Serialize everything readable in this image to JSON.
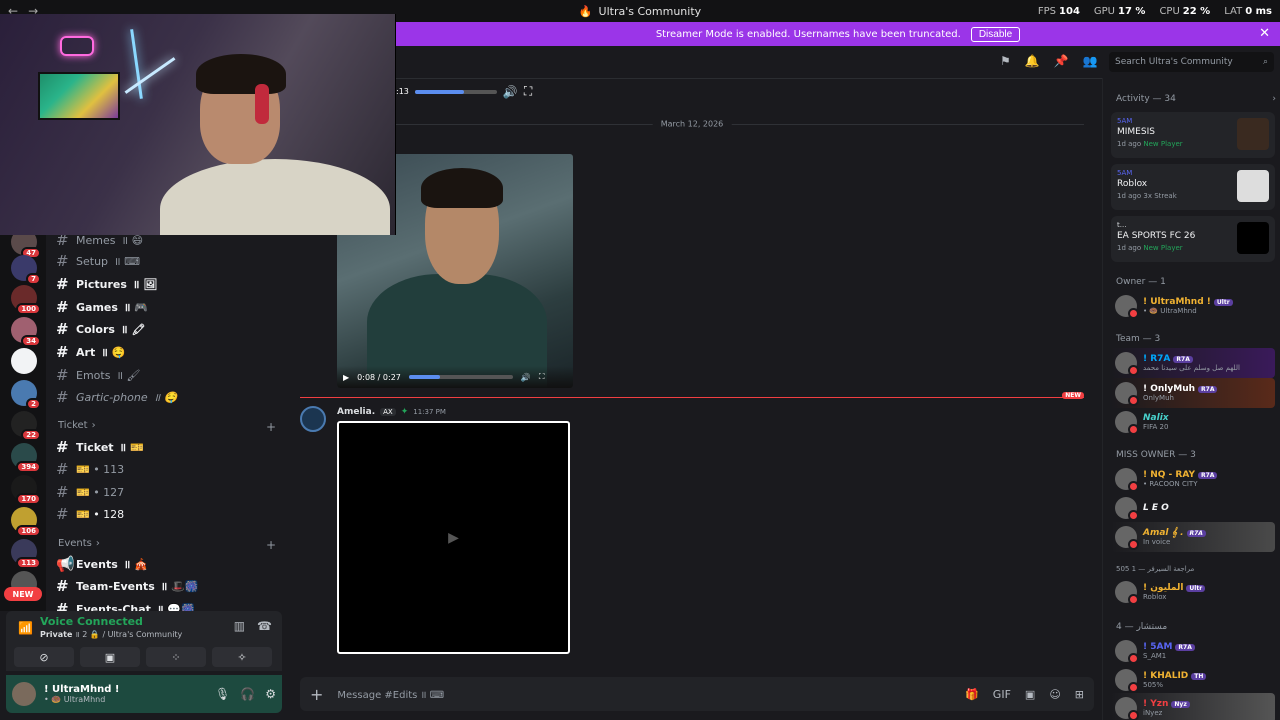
{
  "titlebar": {
    "title": "Ultra's Community",
    "stats": [
      {
        "label": "FPS",
        "value": "104"
      },
      {
        "label": "GPU",
        "value": "17 %"
      },
      {
        "label": "CPU",
        "value": "22 %"
      },
      {
        "label": "LAT",
        "value": "0 ms"
      }
    ]
  },
  "banner": {
    "text": "Streamer Mode is enabled. Usernames have been truncated.",
    "disable_label": "Disable"
  },
  "servers": [
    {
      "badge": "47"
    },
    {
      "badge": "7"
    },
    {
      "badge": "100"
    },
    {
      "badge": "34"
    },
    {
      "badge": ""
    },
    {
      "badge": "2"
    },
    {
      "badge": "22"
    },
    {
      "badge": "394"
    },
    {
      "badge": "170"
    },
    {
      "badge": "106"
    },
    {
      "badge": "113"
    },
    {
      "badge": ""
    }
  ],
  "new_pill": "NEW",
  "channels": {
    "items": [
      {
        "name": "Memes",
        "suffix": "॥ 😄"
      },
      {
        "name": "Setup",
        "suffix": "॥ ⌨"
      },
      {
        "name": "Pictures",
        "suffix": "॥ 🖼"
      },
      {
        "name": "Games",
        "suffix": "॥ 🎮"
      },
      {
        "name": "Colors",
        "suffix": "॥ 🖍"
      },
      {
        "name": "Art",
        "suffix": "॥ 🤤"
      },
      {
        "name": "Emots",
        "suffix": "॥ 🖌"
      },
      {
        "name": "Gartic-phone",
        "suffix": "॥ 🤤"
      }
    ],
    "ticket_category": "Ticket",
    "ticket_items": [
      {
        "name": "Ticket",
        "suffix": "॥ 🎫"
      },
      {
        "name": "🎫 • 113",
        "suffix": ""
      },
      {
        "name": "🎫 • 127",
        "suffix": ""
      },
      {
        "name": "🎫 • 128",
        "suffix": ""
      }
    ],
    "events_category": "Events",
    "events_items": [
      {
        "name": "Events",
        "suffix": "॥ 🎪"
      },
      {
        "name": "Team-Events",
        "suffix": "॥ 🎩🎆"
      },
      {
        "name": "Events-Chat",
        "suffix": "॥ 💬🎆"
      }
    ]
  },
  "voice": {
    "title": "Voice Connected",
    "channel": "Private",
    "sub": "॥ 2 🔒 / Ultra's Community"
  },
  "user": {
    "name": "! UltraMhnd !",
    "status": "• 🍩 UltraMhnd"
  },
  "search": {
    "placeholder": "Search Ultra's Community"
  },
  "video1": {
    "time": ":13"
  },
  "date_separator": "March 12, 2026",
  "video2": {
    "time": "0:08 / 0:27"
  },
  "new_marker": "NEW",
  "message": {
    "author": "Amelia.",
    "tag": "AX",
    "time": "11:37 PM"
  },
  "composer": {
    "placeholder": "Message #Edits ॥ ⌨"
  },
  "activity": {
    "header": "Activity — 34",
    "cards": [
      {
        "who": "5AM",
        "game": "MIMESIS",
        "ago": "1d ago",
        "note": "New Player"
      },
      {
        "who": "5AM",
        "game": "Roblox",
        "ago": "1d ago",
        "note": "3x Streak"
      },
      {
        "who": "t...",
        "game": "EA SPORTS FC 26",
        "ago": "1d ago",
        "note": "New Player"
      }
    ]
  },
  "members": {
    "owner_header": "Owner — 1",
    "owner": [
      {
        "name": "! UltraMhnd !",
        "tag": "Ultr",
        "sub": "• 🍩 UltraMhnd",
        "color": "#f0b232"
      }
    ],
    "team_header": "Team — 3",
    "team": [
      {
        "name": "! R7A",
        "tag": "R7A",
        "sub": "اللهم صل وسلم على سيدنا محمد",
        "color": "#00a8fc"
      },
      {
        "name": "! OnlyMuh",
        "tag": "R7A",
        "sub": "OnlyMuh",
        "color": "#ffffff"
      },
      {
        "name": "Nalix",
        "tag": "",
        "sub": "FIFA 20",
        "color": "#48d1cc"
      }
    ],
    "missowner_header": "MISS OWNER — 3",
    "missowner": [
      {
        "name": "! NQ - RAY",
        "tag": "R7A",
        "sub": "• RACOON CITY",
        "color": "#f0b232"
      },
      {
        "name": "L E O",
        "tag": "",
        "sub": "",
        "color": "#f2f3f5"
      },
      {
        "name": "Amal 𝄞 .",
        "tag": "R7A",
        "sub": "In voice",
        "color": "#f0b232"
      }
    ],
    "review_header": "505 مراجعة السيرفر — 1",
    "review": [
      {
        "name": "! المليون",
        "tag": "Ultr",
        "sub": "Roblox",
        "color": "#f0b232"
      }
    ],
    "mustashar_header": "مستشار — 4",
    "mustashar": [
      {
        "name": "! 5AM",
        "tag": "R7A",
        "sub": "S_AM1",
        "color": "#5865f2"
      },
      {
        "name": "! KHALID",
        "tag": "TH",
        "sub": "505%",
        "color": "#f0b232"
      },
      {
        "name": "! Yzn",
        "tag": "Nyz",
        "sub": "iNyez",
        "color": "#f23f42"
      }
    ]
  }
}
